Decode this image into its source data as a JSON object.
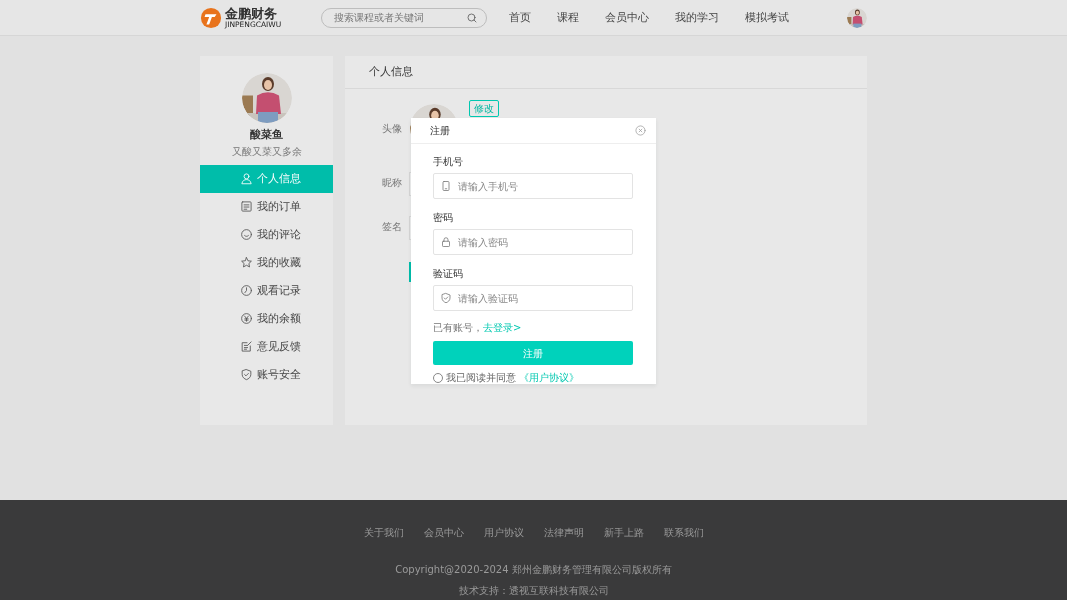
{
  "header": {
    "logo": {
      "name": "金鹏财务",
      "subtitle": "JINPENGCAIWU"
    },
    "search": {
      "placeholder": "搜索课程或者关键词"
    },
    "nav": [
      {
        "label": "首页",
        "selected": false
      },
      {
        "label": "课程",
        "selected": false
      },
      {
        "label": "会员中心",
        "selected": false
      },
      {
        "label": "我的学习",
        "selected": false
      },
      {
        "label": "模拟考试",
        "selected": false
      }
    ]
  },
  "sidebar": {
    "user": {
      "name": "酸菜鱼",
      "motto": "又酸又菜又多余"
    },
    "items": [
      {
        "label": "个人信息",
        "kind": "user",
        "selected": true
      },
      {
        "label": "我的订单",
        "kind": "order",
        "selected": false
      },
      {
        "label": "我的评论",
        "kind": "comment",
        "selected": false
      },
      {
        "label": "我的收藏",
        "kind": "star",
        "selected": false
      },
      {
        "label": "观看记录",
        "kind": "clock",
        "selected": false
      },
      {
        "label": "我的余额",
        "kind": "yen",
        "selected": false
      },
      {
        "label": "意见反馈",
        "kind": "feedback",
        "selected": false
      },
      {
        "label": "账号安全",
        "kind": "shield",
        "selected": false
      }
    ]
  },
  "profile": {
    "title": "个人信息",
    "edit_button": "修改",
    "fields": [
      {
        "label": "头像"
      },
      {
        "label": "昵称"
      },
      {
        "label": "签名"
      }
    ]
  },
  "modal": {
    "title": "注册",
    "fields": [
      {
        "label": "手机号",
        "placeholder": "请输入手机号",
        "kind": "phone"
      },
      {
        "label": "密码",
        "placeholder": "请输入密码",
        "kind": "lock"
      },
      {
        "label": "验证码",
        "placeholder": "请输入验证码",
        "kind": "shield"
      }
    ],
    "login_prompt": "已有账号，",
    "login_link": "去登录>",
    "submit": "注册",
    "agreement": {
      "checked": false,
      "text": "我已阅读并同意",
      "link": "《用户协议》"
    }
  },
  "footer": {
    "links": [
      "关于我们",
      "会员中心",
      "用户协议",
      "法律声明",
      "新手上路",
      "联系我们"
    ],
    "copyright": "Copyright@2020-2024 郑州金鹏财务管理有限公司版权所有",
    "support": "技术支持：透视互联科技有限公司"
  }
}
